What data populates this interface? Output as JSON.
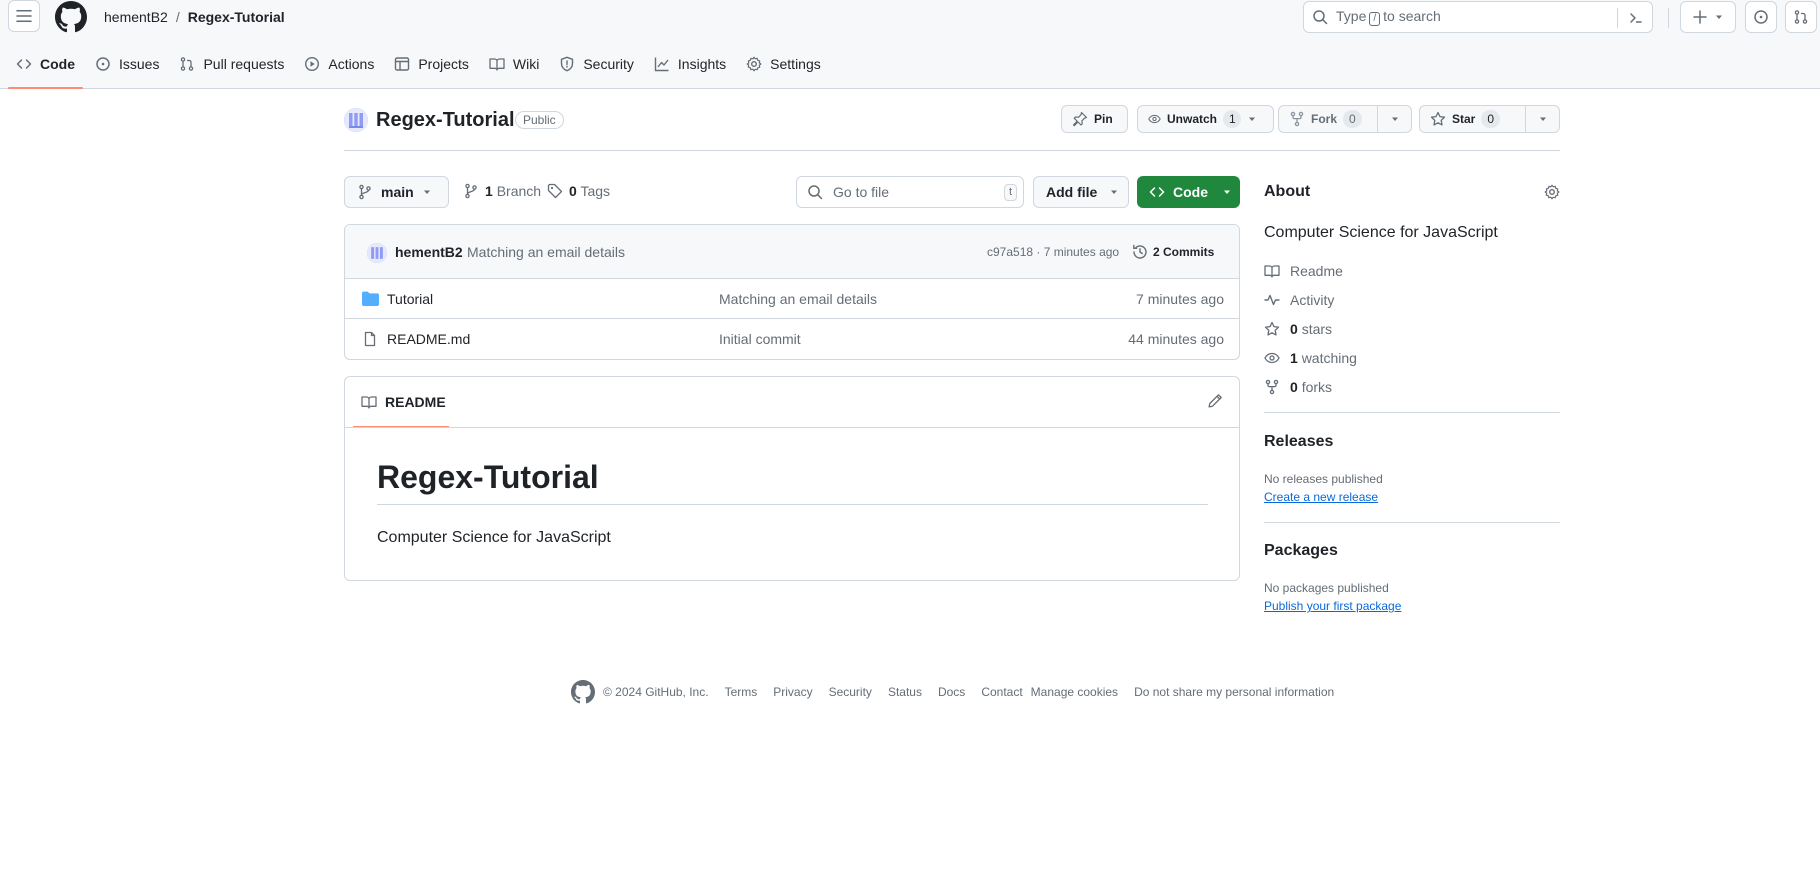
{
  "header": {
    "owner": "hementB2",
    "separator": "/",
    "repo": "Regex-Tutorial",
    "search": {
      "prefix": "Type",
      "key": "/",
      "suffix": "to search"
    }
  },
  "repo_nav": [
    {
      "label": "Code",
      "icon": "code-icon",
      "active": true
    },
    {
      "label": "Issues",
      "icon": "issue-icon"
    },
    {
      "label": "Pull requests",
      "icon": "pull-request-icon"
    },
    {
      "label": "Actions",
      "icon": "play-icon"
    },
    {
      "label": "Projects",
      "icon": "table-icon"
    },
    {
      "label": "Wiki",
      "icon": "book-icon"
    },
    {
      "label": "Security",
      "icon": "shield-icon"
    },
    {
      "label": "Insights",
      "icon": "graph-icon"
    },
    {
      "label": "Settings",
      "icon": "gear-icon"
    }
  ],
  "repo": {
    "name": "Regex-Tutorial",
    "visibility": "Public",
    "actions": {
      "pin": "Pin",
      "unwatch": "Unwatch",
      "watch_count": "1",
      "fork": "Fork",
      "fork_count": "0",
      "star": "Star",
      "star_count": "0"
    }
  },
  "toolbar": {
    "branch": "main",
    "branch_count": "1",
    "branch_label": "Branch",
    "tag_count": "0",
    "tag_label": "Tags",
    "goto_placeholder": "Go to file",
    "goto_key": "t",
    "add_file": "Add file",
    "code": "Code"
  },
  "latest_commit": {
    "author": "hementB2",
    "message": "Matching an email details",
    "sha_time": "c97a518 · 7 minutes ago",
    "commits": "2 Commits"
  },
  "files": [
    {
      "name": "Tutorial",
      "type": "folder",
      "message": "Matching an email details",
      "age": "7 minutes ago"
    },
    {
      "name": "README.md",
      "type": "file",
      "message": "Initial commit",
      "age": "44 minutes ago"
    }
  ],
  "readme": {
    "tab": "README",
    "title": "Regex-Tutorial",
    "body": "Computer Science for JavaScript"
  },
  "about": {
    "heading": "About",
    "description": "Computer Science for JavaScript",
    "readme": "Readme",
    "activity": "Activity",
    "stars_count": "0",
    "stars_label": "stars",
    "watching_count": "1",
    "watching_label": "watching",
    "forks_count": "0",
    "forks_label": "forks"
  },
  "releases": {
    "heading": "Releases",
    "empty": "No releases published",
    "link": "Create a new release"
  },
  "packages": {
    "heading": "Packages",
    "empty": "No packages published",
    "link": "Publish your first package"
  },
  "footer": {
    "copyright": "© 2024 GitHub, Inc.",
    "links": [
      "Terms",
      "Privacy",
      "Security",
      "Status",
      "Docs",
      "Contact",
      "Manage cookies",
      "Do not share my personal information"
    ]
  },
  "colors": {
    "accent_underline": "#fd8c73",
    "primary_button": "#1f883d",
    "link": "#0969da",
    "folder": "#54aeff"
  }
}
